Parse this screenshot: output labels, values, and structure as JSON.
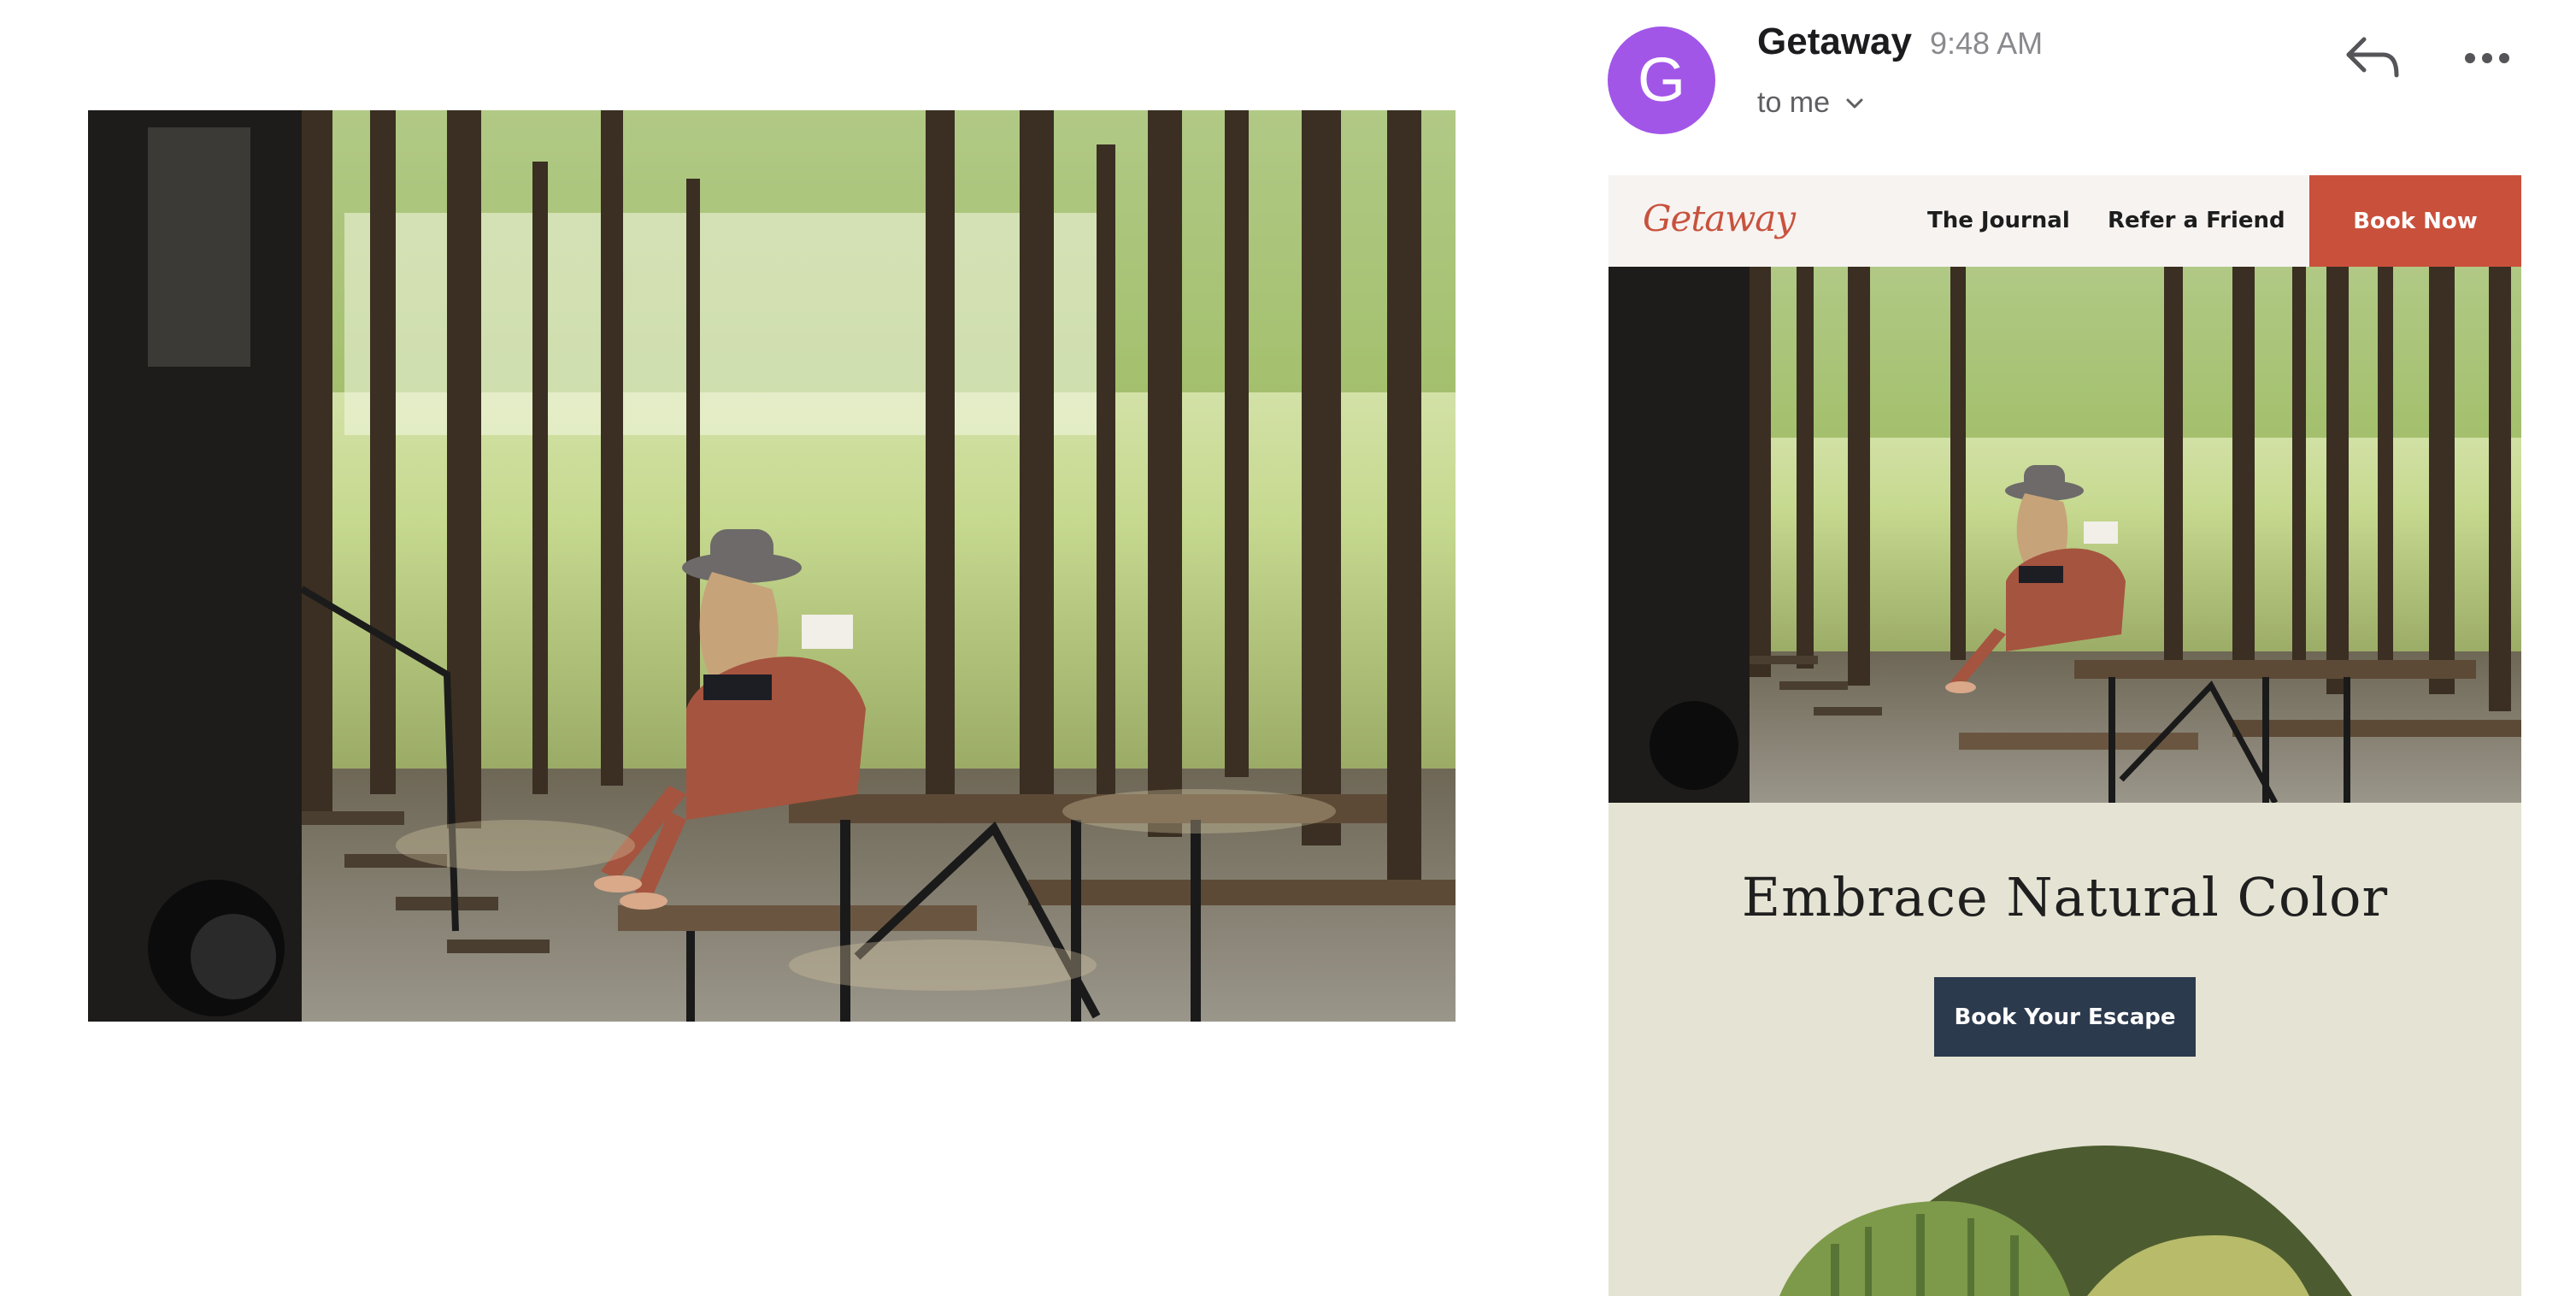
{
  "email": {
    "avatar_initial": "G",
    "sender_name": "Getaway",
    "time": "9:48 AM",
    "recipient": "to me"
  },
  "newsletter": {
    "brand": "Getaway",
    "nav": {
      "journal": "The Journal",
      "refer": "Refer a Friend",
      "book_now": "Book Now"
    },
    "headline": "Embrace Natural Color",
    "cta": "Book Your Escape"
  },
  "icons": {
    "reply": "reply-icon",
    "more": "more-icon",
    "chevron": "chevron-down-icon"
  },
  "colors": {
    "avatar": "#a256e8",
    "brand_accent": "#c9503b",
    "cta_button": "#2c3a4e",
    "body_background": "#e5e3d3",
    "nav_background": "#f7f3f1"
  }
}
